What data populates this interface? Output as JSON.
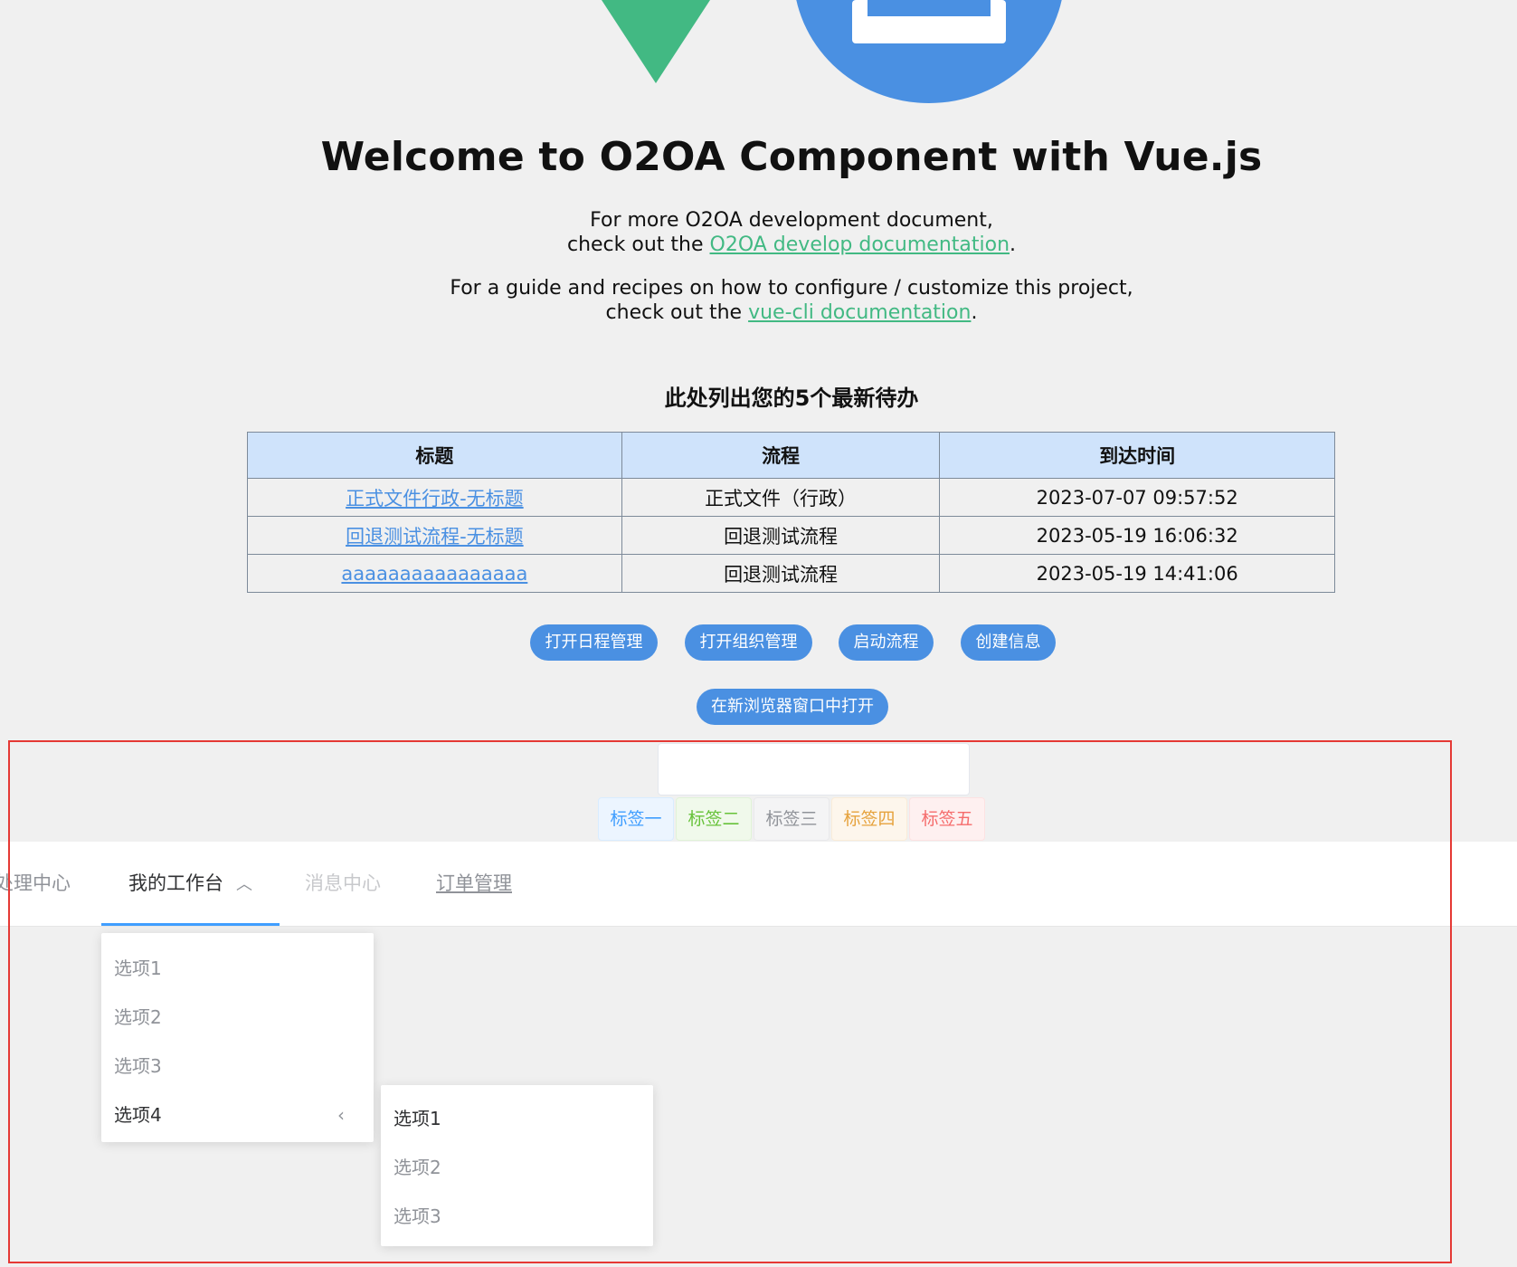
{
  "header": {
    "title": "Welcome to O2OA Component with Vue.js",
    "intro1_line1": "For more O2OA development document,",
    "intro1_prefix": "check out the ",
    "intro1_link": "O2OA develop documentation",
    "intro1_suffix": ".",
    "intro2_line1": "For a guide and recipes on how to configure / customize this project,",
    "intro2_prefix": "check out the ",
    "intro2_link": "vue-cli documentation",
    "intro2_suffix": "."
  },
  "tasks": {
    "heading": "此处列出您的5个最新待办",
    "columns": [
      "标题",
      "流程",
      "到达时间"
    ],
    "rows": [
      {
        "title": "正式文件行政-无标题",
        "process": "正式文件（行政）",
        "time": "2023-07-07 09:57:52"
      },
      {
        "title": "回退测试流程-无标题",
        "process": "回退测试流程",
        "time": "2023-05-19 16:06:32"
      },
      {
        "title": "aaaaaaaaaaaaaaaa",
        "process": "回退测试流程",
        "time": "2023-05-19 14:41:06"
      }
    ]
  },
  "actions": {
    "calendar": "打开日程管理",
    "org": "打开组织管理",
    "start_process": "启动流程",
    "create_info": "创建信息",
    "open_new_window": "在新浏览器窗口中打开"
  },
  "tags": [
    {
      "label": "标签一",
      "color": "#409eff",
      "bg": "#ecf5ff",
      "border": "#d9ecff"
    },
    {
      "label": "标签二",
      "color": "#67c23a",
      "bg": "#f0f9eb",
      "border": "#e1f3d8"
    },
    {
      "label": "标签三",
      "color": "#909399",
      "bg": "#f4f4f5",
      "border": "#e9e9eb"
    },
    {
      "label": "标签四",
      "color": "#e6a23c",
      "bg": "#fdf6ec",
      "border": "#faecd8"
    },
    {
      "label": "标签五",
      "color": "#f56c6c",
      "bg": "#fef0f0",
      "border": "#fde2e2"
    }
  ],
  "menu": {
    "item1": "处理中心",
    "item2": "我的工作台",
    "item3": "消息中心",
    "item4": "订单管理",
    "accent": "#409eff"
  },
  "submenu": {
    "items": [
      "选项1",
      "选项2",
      "选项3",
      "选项4"
    ]
  },
  "submenu_nested": {
    "items": [
      "选项1",
      "选项2",
      "选项3"
    ]
  },
  "colors": {
    "vue_green": "#42b983",
    "primary_blue": "#4a90e2",
    "table_header_bg": "#cfe3fb",
    "frame_red": "#e53935"
  }
}
